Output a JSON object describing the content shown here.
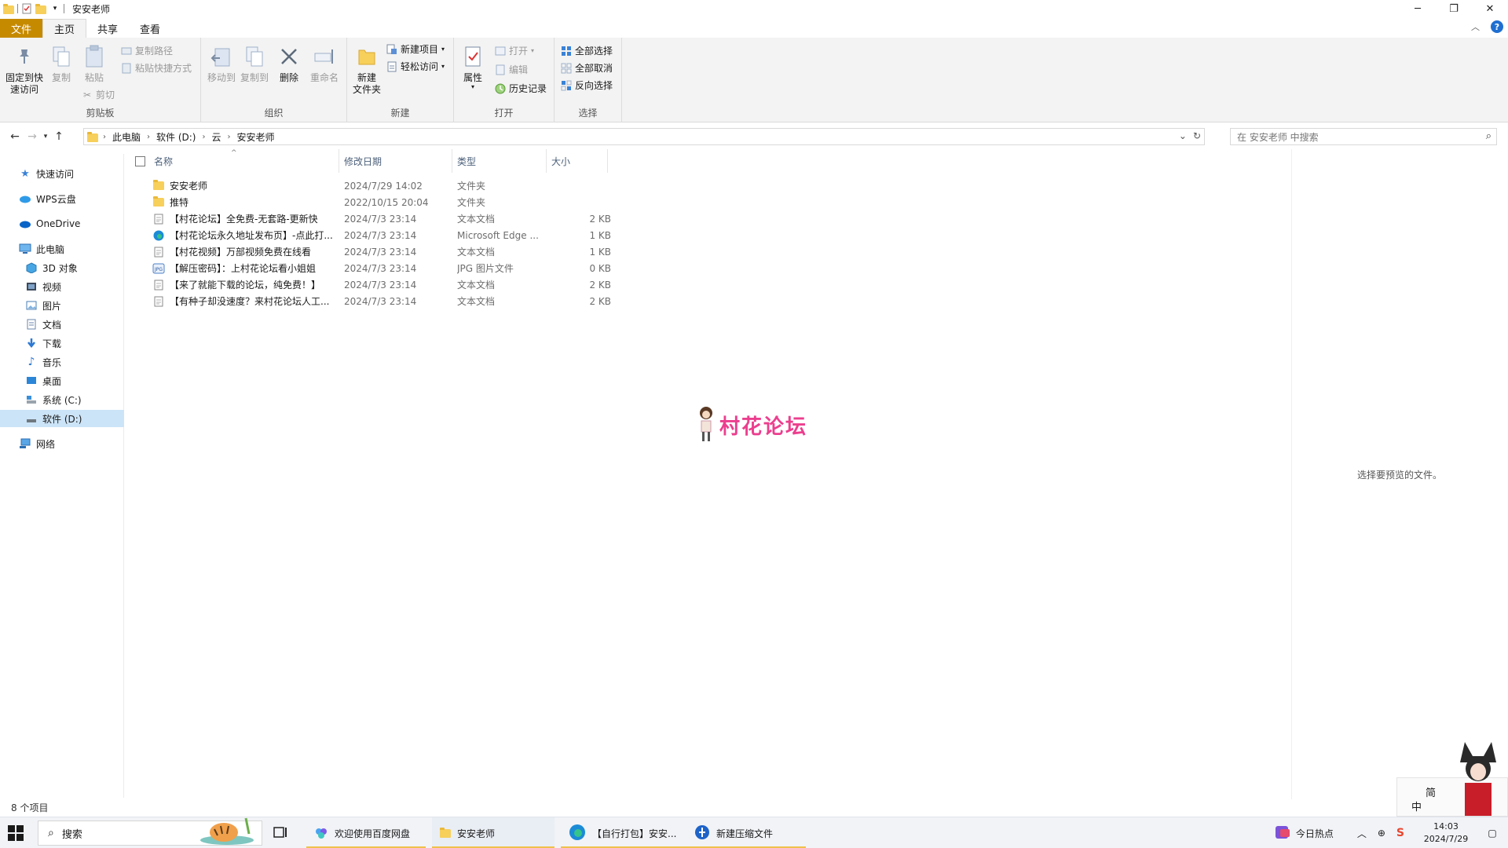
{
  "window": {
    "title": "安安老师",
    "controls": [
      "─",
      "❐",
      "✕"
    ]
  },
  "ribbon_tabs": [
    "文件",
    "主页",
    "共享",
    "查看"
  ],
  "ribbon": {
    "clipboard": {
      "pin": "固定到快\n速访问",
      "copy": "复制",
      "paste": "粘贴",
      "copy_path": "复制路径",
      "paste_shortcut": "粘贴快捷方式",
      "cut": "剪切",
      "label": "剪贴板"
    },
    "organize": {
      "move_to": "移动到",
      "copy_to": "复制到",
      "delete": "删除",
      "rename": "重命名",
      "label": "组织"
    },
    "new": {
      "new_folder": "新建\n文件夹",
      "new_item": "新建项目",
      "easy_access": "轻松访问",
      "label": "新建"
    },
    "open": {
      "properties": "属性",
      "open": "打开",
      "edit": "编辑",
      "history": "历史记录",
      "label": "打开"
    },
    "select": {
      "select_all": "全部选择",
      "select_none": "全部取消",
      "invert": "反向选择",
      "label": "选择"
    }
  },
  "address": {
    "crumbs": [
      "此电脑",
      "软件 (D:)",
      "云",
      "安安老师"
    ],
    "search_placeholder": "在 安安老师 中搜索"
  },
  "sidebar": {
    "items": [
      {
        "label": "快速访问",
        "icon": "star-icon"
      },
      {
        "label": "WPS云盘",
        "icon": "cloud-icon"
      },
      {
        "label": "OneDrive",
        "icon": "onedrive-icon"
      },
      {
        "label": "此电脑",
        "icon": "pc-icon"
      },
      {
        "label": "3D 对象",
        "icon": "cube-icon"
      },
      {
        "label": "视频",
        "icon": "video-icon"
      },
      {
        "label": "图片",
        "icon": "picture-icon"
      },
      {
        "label": "文档",
        "icon": "document-icon"
      },
      {
        "label": "下载",
        "icon": "download-icon"
      },
      {
        "label": "音乐",
        "icon": "music-icon"
      },
      {
        "label": "桌面",
        "icon": "desktop-icon"
      },
      {
        "label": "系统 (C:)",
        "icon": "drive-icon"
      },
      {
        "label": "软件 (D:)",
        "icon": "drive-icon"
      },
      {
        "label": "网络",
        "icon": "network-icon"
      }
    ]
  },
  "columns": [
    "名称",
    "修改日期",
    "类型",
    "大小"
  ],
  "files": [
    {
      "name": "安安老师",
      "date": "2024/7/29 14:02",
      "type": "文件夹",
      "size": "",
      "icon": "folder-icon"
    },
    {
      "name": "推特",
      "date": "2022/10/15 20:04",
      "type": "文件夹",
      "size": "",
      "icon": "folder-icon"
    },
    {
      "name": "【村花论坛】全免费-无套路-更新快",
      "date": "2024/7/3 23:14",
      "type": "文本文档",
      "size": "2 KB",
      "icon": "text-file-icon"
    },
    {
      "name": "【村花论坛永久地址发布页】-点此打...",
      "date": "2024/7/3 23:14",
      "type": "Microsoft Edge ...",
      "size": "1 KB",
      "icon": "edge-icon"
    },
    {
      "name": "【村花视频】万部视频免费在线看",
      "date": "2024/7/3 23:14",
      "type": "文本文档",
      "size": "1 KB",
      "icon": "text-file-icon"
    },
    {
      "name": "【解压密码】：上村花论坛看小姐姐",
      "date": "2024/7/3 23:14",
      "type": "JPG 图片文件",
      "size": "0 KB",
      "icon": "jpg-icon"
    },
    {
      "name": "【来了就能下载的论坛，纯免费！】",
      "date": "2024/7/3 23:14",
      "type": "文本文档",
      "size": "2 KB",
      "icon": "text-file-icon"
    },
    {
      "name": "【有种子却没速度？来村花论坛人工...",
      "date": "2024/7/3 23:14",
      "type": "文本文档",
      "size": "2 KB",
      "icon": "text-file-icon"
    }
  ],
  "preview_message": "选择要预览的文件。",
  "watermark": "村花论坛",
  "status": "8 个项目",
  "taskbar": {
    "search_label": "搜索",
    "tasks": [
      {
        "label": "欢迎使用百度网盘",
        "icon": "baidu-icon"
      },
      {
        "label": "安安老师",
        "icon": "folder-icon"
      },
      {
        "label": "【自行打包】安安...",
        "icon": "edge-icon"
      },
      {
        "label": "新建压缩文件",
        "icon": "archive-icon"
      }
    ],
    "hot_news": "今日热点",
    "ime_simplified": "简",
    "ime_chinese": "中",
    "time": "14:03",
    "date": "2024/7/29"
  },
  "colors": {
    "file_tab": "#c68a00",
    "accent": "#1f6fd1",
    "folder": "#f7cf5b",
    "selected": "#cce4f7",
    "watermark": "#ec3e8e"
  }
}
